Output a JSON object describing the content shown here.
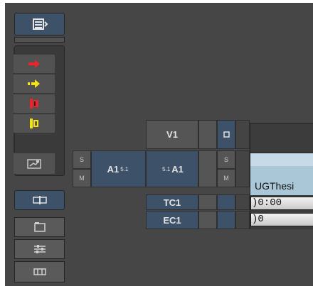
{
  "toolbar": {
    "top_button_icon": "panel-menu-icon",
    "group_buttons": [
      {
        "icon": "red-arrow-right-icon",
        "color": "#e8262e"
      },
      {
        "icon": "yellow-arrow-right-icon",
        "color": "#f4e21c"
      },
      {
        "icon": "red-clip-icon",
        "color": "#e8262e"
      },
      {
        "icon": "yellow-clip-icon",
        "color": "#f4e21c"
      },
      {
        "icon": "screen-edit-icon",
        "color": "#c8c8c8"
      }
    ],
    "bottom_buttons": [
      {
        "icon": "split-track-icon"
      },
      {
        "icon": "clip-frame-icon"
      },
      {
        "icon": "mixer-sliders-icon"
      },
      {
        "icon": "grid-view-icon"
      }
    ]
  },
  "tracks": {
    "v1": {
      "record_label": "V1"
    },
    "a1": {
      "source_label": "A1",
      "source_format": "5.1",
      "record_format": "5.1",
      "record_label": "A1",
      "solo": "S",
      "mute": "M",
      "rec_solo": "S",
      "rec_mute": "M"
    },
    "tc1": {
      "label": "TC1"
    },
    "ec1": {
      "label": "EC1"
    }
  },
  "timeline": {
    "clip_name": "UGThesi",
    "tc_value": ")0:00",
    "ec_value": ")0"
  }
}
